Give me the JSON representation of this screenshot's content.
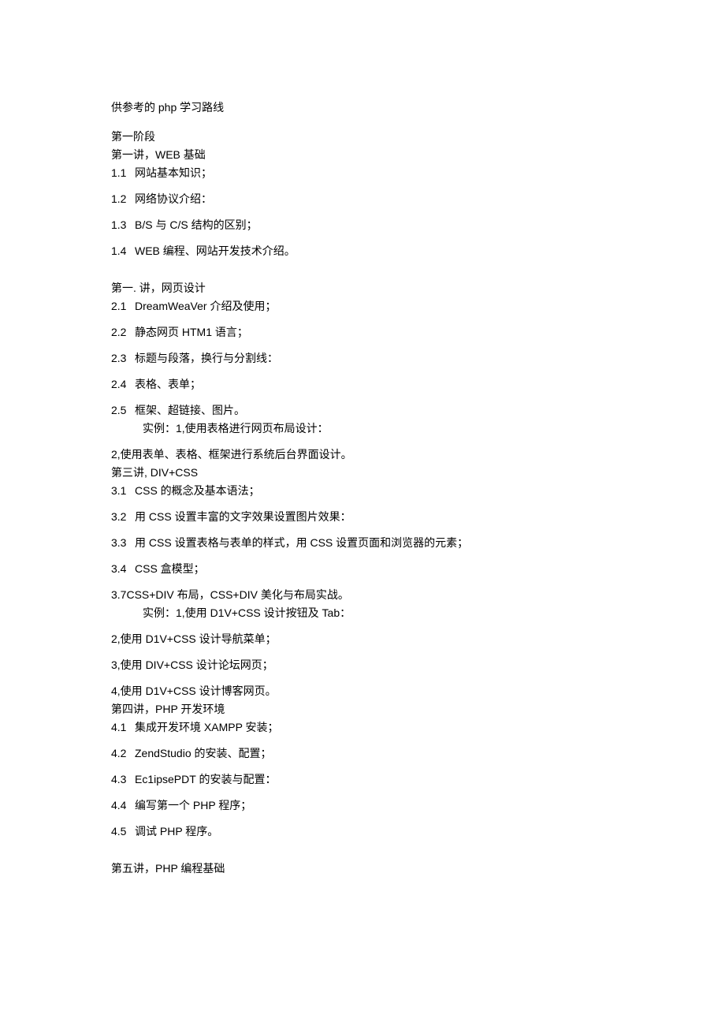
{
  "title": "供参考的 php 学习路线",
  "stage1": {
    "label": "第一阶段",
    "lec1": {
      "header": "第一讲，WEB 基础",
      "i1": {
        "n": "1.1",
        "t": "网站基本知识；"
      },
      "i2": {
        "n": "1.2",
        "t": "网络协议介绍："
      },
      "i3": {
        "n": "1.3",
        "t": "B/S 与 C/S 结构的区别；"
      },
      "i4": {
        "n": "1.4",
        "t": "WEB 编程、网站开发技术介绍。"
      }
    },
    "lec2": {
      "header": "第一. 讲，网页设计",
      "i1": {
        "n": "2.1",
        "t": "DreamWeaVer 介绍及使用；"
      },
      "i2": {
        "n": "2.2",
        "t": "静态网页 HTM1 语言；"
      },
      "i3": {
        "n": "2.3",
        "t": "标题与段落，换行与分割线："
      },
      "i4": {
        "n": "2.4",
        "t": "表格、表单；"
      },
      "i5": {
        "n": "2.5",
        "t": "框架、超链接、图片。"
      },
      "i5b": "实例：1,使用表格进行网页布局设计：",
      "p1": "2,使用表单、表格、框架进行系统后台界面设计。"
    },
    "lec3": {
      "header": "第三讲, DIV+CSS",
      "i1": {
        "n": "3.1",
        "t": "CSS 的概念及基本语法；"
      },
      "i2": {
        "n": "3.2",
        "t": "用 CSS 设置丰富的文字效果设置图片效果："
      },
      "i3": {
        "n": "3.3",
        "t": "用 CSS 设置表格与表单的样式，用 CSS 设置页面和浏览器的元素；"
      },
      "i4": {
        "n": "3.4",
        "t": "CSS 盒模型；"
      },
      "p1": "3.7CSS+DIV 布局，CSS+DIV 美化与布局实战。",
      "p1b": "实例：1,使用 D1V+CSS 设计按钮及 Tab：",
      "p2": "2,使用 D1V+CSS 设计导航菜单；",
      "p3": "3,使用 DIV+CSS 设计论坛网页；",
      "p4": "4,使用 D1V+CSS 设计博客网页。"
    },
    "lec4": {
      "header": "第四讲，PHP 开发环境",
      "i1": {
        "n": "4.1",
        "t": "集成开发环境 XAMPP 安装；"
      },
      "i2": {
        "n": "4.2",
        "t": "ZendStudio 的安装、配置；"
      },
      "i3": {
        "n": "4.3",
        "t": "Ec1ipsePDT 的安装与配置："
      },
      "i4": {
        "n": "4.4",
        "t": "编写第一个 PHP 程序；"
      },
      "i5": {
        "n": "4.5",
        "t": "调试 PHP 程序。"
      }
    },
    "lec5": {
      "header": "第五讲，PHP 编程基础"
    }
  }
}
